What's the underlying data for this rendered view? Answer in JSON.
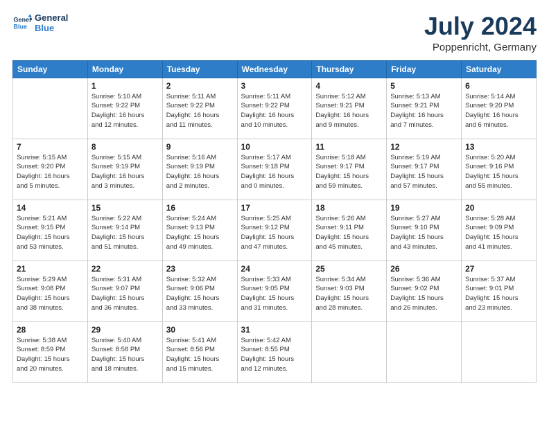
{
  "header": {
    "logo_line1": "General",
    "logo_line2": "Blue",
    "month": "July 2024",
    "location": "Poppenricht, Germany"
  },
  "days_of_week": [
    "Sunday",
    "Monday",
    "Tuesday",
    "Wednesday",
    "Thursday",
    "Friday",
    "Saturday"
  ],
  "weeks": [
    [
      {
        "day": "",
        "info": ""
      },
      {
        "day": "1",
        "info": "Sunrise: 5:10 AM\nSunset: 9:22 PM\nDaylight: 16 hours\nand 12 minutes."
      },
      {
        "day": "2",
        "info": "Sunrise: 5:11 AM\nSunset: 9:22 PM\nDaylight: 16 hours\nand 11 minutes."
      },
      {
        "day": "3",
        "info": "Sunrise: 5:11 AM\nSunset: 9:22 PM\nDaylight: 16 hours\nand 10 minutes."
      },
      {
        "day": "4",
        "info": "Sunrise: 5:12 AM\nSunset: 9:21 PM\nDaylight: 16 hours\nand 9 minutes."
      },
      {
        "day": "5",
        "info": "Sunrise: 5:13 AM\nSunset: 9:21 PM\nDaylight: 16 hours\nand 7 minutes."
      },
      {
        "day": "6",
        "info": "Sunrise: 5:14 AM\nSunset: 9:20 PM\nDaylight: 16 hours\nand 6 minutes."
      }
    ],
    [
      {
        "day": "7",
        "info": "Sunrise: 5:15 AM\nSunset: 9:20 PM\nDaylight: 16 hours\nand 5 minutes."
      },
      {
        "day": "8",
        "info": "Sunrise: 5:15 AM\nSunset: 9:19 PM\nDaylight: 16 hours\nand 3 minutes."
      },
      {
        "day": "9",
        "info": "Sunrise: 5:16 AM\nSunset: 9:19 PM\nDaylight: 16 hours\nand 2 minutes."
      },
      {
        "day": "10",
        "info": "Sunrise: 5:17 AM\nSunset: 9:18 PM\nDaylight: 16 hours\nand 0 minutes."
      },
      {
        "day": "11",
        "info": "Sunrise: 5:18 AM\nSunset: 9:17 PM\nDaylight: 15 hours\nand 59 minutes."
      },
      {
        "day": "12",
        "info": "Sunrise: 5:19 AM\nSunset: 9:17 PM\nDaylight: 15 hours\nand 57 minutes."
      },
      {
        "day": "13",
        "info": "Sunrise: 5:20 AM\nSunset: 9:16 PM\nDaylight: 15 hours\nand 55 minutes."
      }
    ],
    [
      {
        "day": "14",
        "info": "Sunrise: 5:21 AM\nSunset: 9:15 PM\nDaylight: 15 hours\nand 53 minutes."
      },
      {
        "day": "15",
        "info": "Sunrise: 5:22 AM\nSunset: 9:14 PM\nDaylight: 15 hours\nand 51 minutes."
      },
      {
        "day": "16",
        "info": "Sunrise: 5:24 AM\nSunset: 9:13 PM\nDaylight: 15 hours\nand 49 minutes."
      },
      {
        "day": "17",
        "info": "Sunrise: 5:25 AM\nSunset: 9:12 PM\nDaylight: 15 hours\nand 47 minutes."
      },
      {
        "day": "18",
        "info": "Sunrise: 5:26 AM\nSunset: 9:11 PM\nDaylight: 15 hours\nand 45 minutes."
      },
      {
        "day": "19",
        "info": "Sunrise: 5:27 AM\nSunset: 9:10 PM\nDaylight: 15 hours\nand 43 minutes."
      },
      {
        "day": "20",
        "info": "Sunrise: 5:28 AM\nSunset: 9:09 PM\nDaylight: 15 hours\nand 41 minutes."
      }
    ],
    [
      {
        "day": "21",
        "info": "Sunrise: 5:29 AM\nSunset: 9:08 PM\nDaylight: 15 hours\nand 38 minutes."
      },
      {
        "day": "22",
        "info": "Sunrise: 5:31 AM\nSunset: 9:07 PM\nDaylight: 15 hours\nand 36 minutes."
      },
      {
        "day": "23",
        "info": "Sunrise: 5:32 AM\nSunset: 9:06 PM\nDaylight: 15 hours\nand 33 minutes."
      },
      {
        "day": "24",
        "info": "Sunrise: 5:33 AM\nSunset: 9:05 PM\nDaylight: 15 hours\nand 31 minutes."
      },
      {
        "day": "25",
        "info": "Sunrise: 5:34 AM\nSunset: 9:03 PM\nDaylight: 15 hours\nand 28 minutes."
      },
      {
        "day": "26",
        "info": "Sunrise: 5:36 AM\nSunset: 9:02 PM\nDaylight: 15 hours\nand 26 minutes."
      },
      {
        "day": "27",
        "info": "Sunrise: 5:37 AM\nSunset: 9:01 PM\nDaylight: 15 hours\nand 23 minutes."
      }
    ],
    [
      {
        "day": "28",
        "info": "Sunrise: 5:38 AM\nSunset: 8:59 PM\nDaylight: 15 hours\nand 20 minutes."
      },
      {
        "day": "29",
        "info": "Sunrise: 5:40 AM\nSunset: 8:58 PM\nDaylight: 15 hours\nand 18 minutes."
      },
      {
        "day": "30",
        "info": "Sunrise: 5:41 AM\nSunset: 8:56 PM\nDaylight: 15 hours\nand 15 minutes."
      },
      {
        "day": "31",
        "info": "Sunrise: 5:42 AM\nSunset: 8:55 PM\nDaylight: 15 hours\nand 12 minutes."
      },
      {
        "day": "",
        "info": ""
      },
      {
        "day": "",
        "info": ""
      },
      {
        "day": "",
        "info": ""
      }
    ]
  ]
}
